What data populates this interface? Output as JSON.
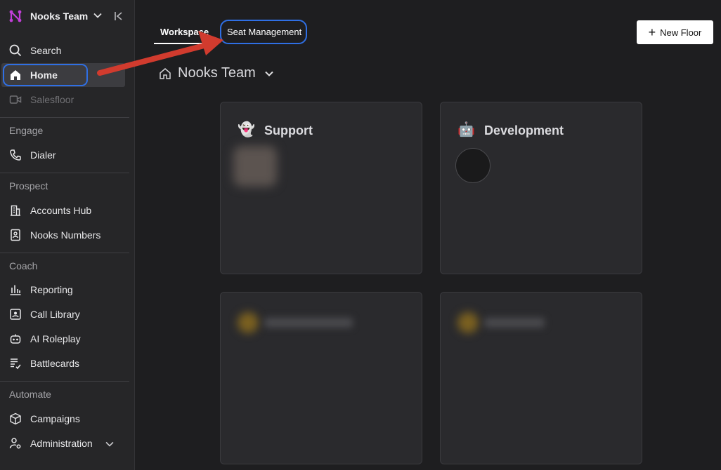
{
  "sidebar": {
    "team_name": "Nooks Team",
    "items_top": [
      {
        "label": "Search",
        "icon": "search-icon"
      },
      {
        "label": "Home",
        "icon": "home-icon"
      },
      {
        "label": "Salesfloor",
        "icon": "video-icon"
      }
    ],
    "sections": [
      {
        "label": "Engage",
        "items": [
          {
            "label": "Dialer",
            "icon": "phone-icon"
          }
        ]
      },
      {
        "label": "Prospect",
        "items": [
          {
            "label": "Accounts Hub",
            "icon": "building-icon"
          },
          {
            "label": "Nooks Numbers",
            "icon": "contact-book-icon"
          }
        ]
      },
      {
        "label": "Coach",
        "items": [
          {
            "label": "Reporting",
            "icon": "bar-chart-icon"
          },
          {
            "label": "Call Library",
            "icon": "library-icon"
          },
          {
            "label": "AI Roleplay",
            "icon": "robot-icon"
          },
          {
            "label": "Battlecards",
            "icon": "cards-icon"
          }
        ]
      },
      {
        "label": "Automate",
        "items": [
          {
            "label": "Campaigns",
            "icon": "cube-icon"
          },
          {
            "label": "Administration",
            "icon": "admin-gear-icon"
          }
        ]
      }
    ]
  },
  "tabs": {
    "workspace": "Workspace",
    "seat_management": "Seat Management"
  },
  "toolbar": {
    "new_floor_label": "New Floor"
  },
  "team_header": {
    "title": "Nooks Team"
  },
  "rooms": [
    {
      "title": "Support",
      "emoji": "👻"
    },
    {
      "title": "Development",
      "emoji": "🤖"
    }
  ],
  "colors": {
    "highlight": "#2f6fe4",
    "arrow": "#d13b2e",
    "accent_logo": "#c23fd8"
  }
}
